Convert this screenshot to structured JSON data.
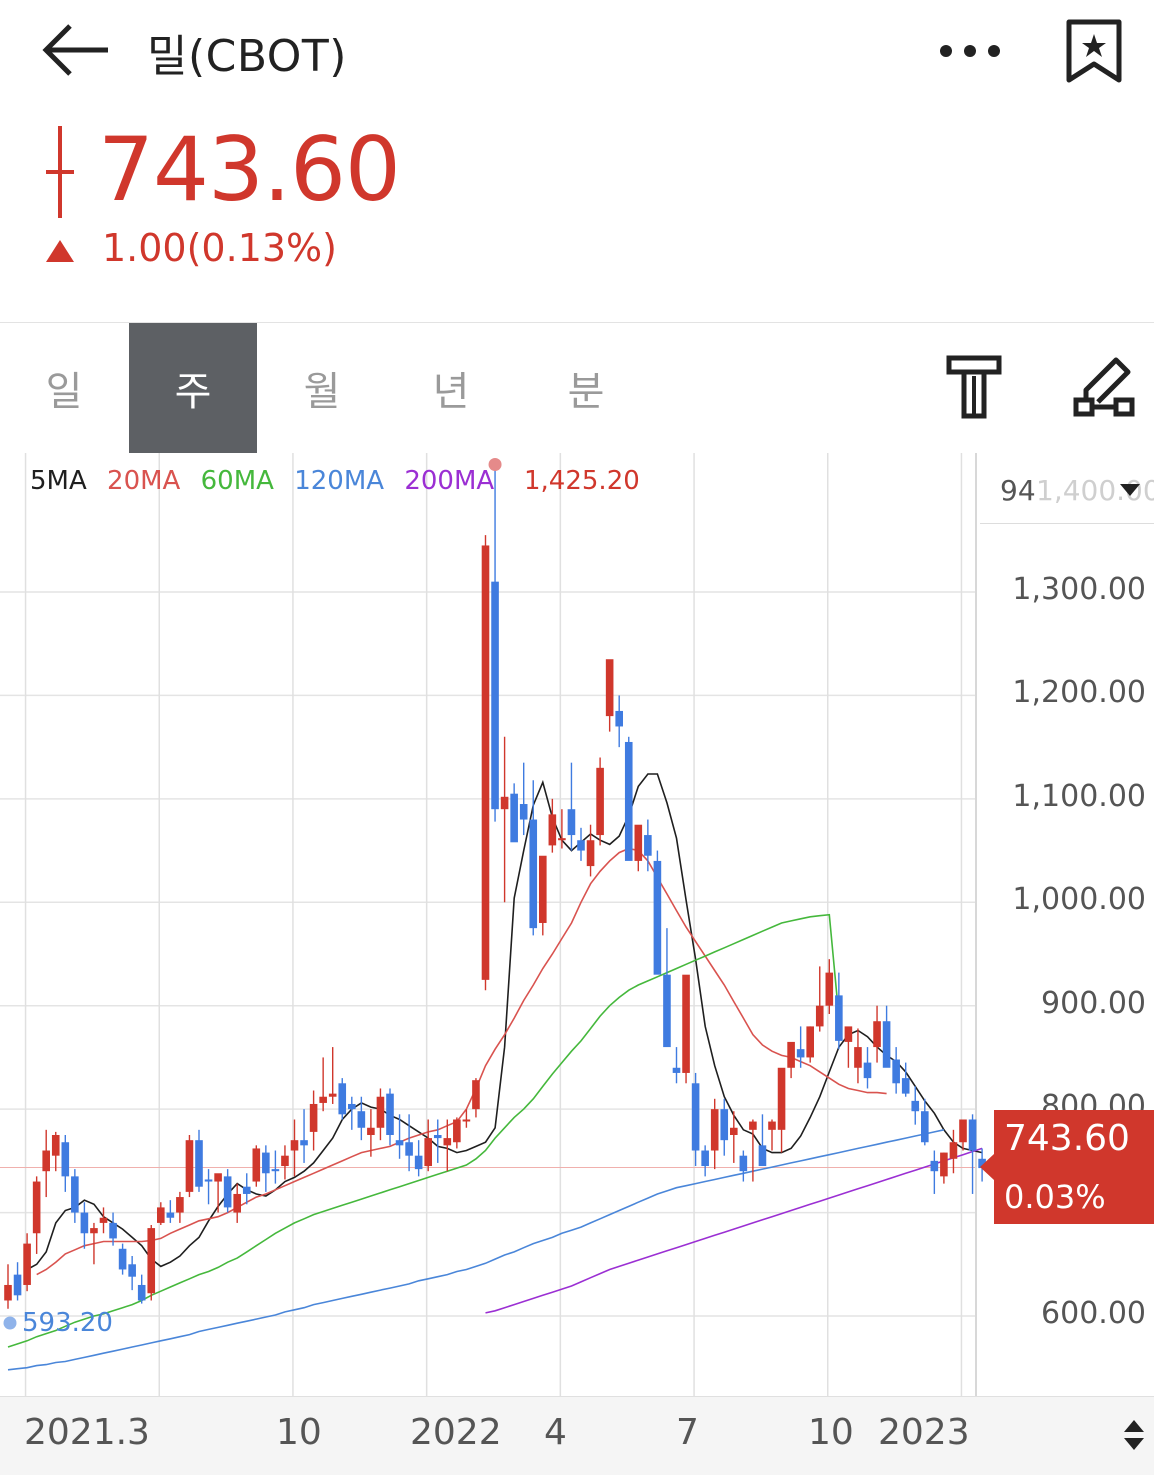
{
  "header": {
    "title": "밀(CBOT)",
    "icons": [
      "back-arrow-icon",
      "more-icon",
      "bookmark-star-icon"
    ]
  },
  "quote": {
    "price": "743.60",
    "change_text": "1.00(0.13%)",
    "direction": "up",
    "up_color": "#d0372c"
  },
  "tabs": [
    {
      "label": "일",
      "active": false
    },
    {
      "label": "주",
      "active": true
    },
    {
      "label": "월",
      "active": false
    },
    {
      "label": "년",
      "active": false
    },
    {
      "label": "분",
      "active": false
    }
  ],
  "toolbar": {
    "icons": [
      "indicator-settings-icon",
      "drawing-tool-icon"
    ]
  },
  "legend": {
    "ma5": "5MA",
    "ma20": "20MA",
    "ma60": "60MA",
    "ma120": "120MA",
    "ma200": "200MA"
  },
  "chart_labels": {
    "high": "1,425.20",
    "low": "593.20",
    "scale_value": "94",
    "scale_ghost": "1,400.00",
    "current_price": "743.60",
    "current_pct": "0.03%"
  },
  "chart_data": {
    "type": "candlestick",
    "interval": "weekly",
    "y_range": [
      530,
      1445
    ],
    "y_ticks": [
      {
        "value": 1300,
        "label": "1,300.00"
      },
      {
        "value": 1200,
        "label": "1,200.00"
      },
      {
        "value": 1100,
        "label": "1,100.00"
      },
      {
        "value": 1000,
        "label": "1,000.00"
      },
      {
        "value": 900,
        "label": "900.00"
      },
      {
        "value": 800,
        "label": "800.00"
      },
      {
        "value": 600,
        "label": "600.00"
      }
    ],
    "x_labels": [
      {
        "index": 9,
        "label": "2021.3"
      },
      {
        "index": 39,
        "label": "10"
      },
      {
        "index": 49,
        "label": "2022"
      },
      {
        "index": 63,
        "label": "4"
      },
      {
        "index": 76,
        "label": "7"
      },
      {
        "index": 90,
        "label": "10"
      },
      {
        "index": 100,
        "label": "2023"
      }
    ],
    "gridline_indices": [
      1,
      15,
      29,
      43,
      57,
      71,
      85,
      99
    ],
    "candles_ohlc": [
      [
        615,
        650,
        607,
        630
      ],
      [
        640,
        652,
        615,
        620
      ],
      [
        630,
        680,
        624,
        670
      ],
      [
        680,
        735,
        660,
        730
      ],
      [
        740,
        780,
        715,
        760
      ],
      [
        755,
        778,
        740,
        775
      ],
      [
        768,
        775,
        720,
        735
      ],
      [
        735,
        742,
        690,
        700
      ],
      [
        700,
        710,
        665,
        680
      ],
      [
        680,
        690,
        650,
        685
      ],
      [
        690,
        705,
        680,
        695
      ],
      [
        690,
        700,
        668,
        675
      ],
      [
        665,
        670,
        640,
        645
      ],
      [
        650,
        658,
        625,
        638
      ],
      [
        630,
        640,
        612,
        615
      ],
      [
        622,
        688,
        615,
        685
      ],
      [
        690,
        710,
        688,
        705
      ],
      [
        700,
        712,
        690,
        695
      ],
      [
        700,
        720,
        690,
        715
      ],
      [
        720,
        775,
        715,
        770
      ],
      [
        770,
        780,
        720,
        725
      ],
      [
        732,
        742,
        708,
        730
      ],
      [
        730,
        735,
        700,
        738
      ],
      [
        735,
        742,
        700,
        705
      ],
      [
        700,
        728,
        690,
        718
      ],
      [
        725,
        738,
        708,
        718
      ],
      [
        730,
        765,
        725,
        762
      ],
      [
        758,
        765,
        720,
        738
      ],
      [
        742,
        760,
        728,
        740
      ],
      [
        745,
        765,
        732,
        755
      ],
      [
        760,
        790,
        735,
        770
      ],
      [
        770,
        800,
        748,
        765
      ],
      [
        778,
        818,
        760,
        805
      ],
      [
        806,
        850,
        798,
        812
      ],
      [
        812,
        860,
        805,
        815
      ],
      [
        825,
        830,
        790,
        795
      ],
      [
        805,
        812,
        780,
        800
      ],
      [
        798,
        812,
        770,
        782
      ],
      [
        775,
        800,
        754,
        782
      ],
      [
        782,
        820,
        770,
        812
      ],
      [
        815,
        820,
        765,
        775
      ],
      [
        770,
        795,
        752,
        765
      ],
      [
        768,
        795,
        740,
        755
      ],
      [
        755,
        770,
        735,
        742
      ],
      [
        745,
        790,
        740,
        772
      ],
      [
        775,
        790,
        748,
        772
      ],
      [
        765,
        790,
        740,
        772
      ],
      [
        768,
        792,
        762,
        790
      ],
      [
        790,
        800,
        782,
        790
      ],
      [
        800,
        830,
        792,
        828
      ],
      [
        925,
        1355,
        915,
        1345
      ],
      [
        1310,
        1425,
        1078,
        1090
      ],
      [
        1090,
        1160,
        1000,
        1102
      ],
      [
        1105,
        1115,
        1060,
        1058
      ],
      [
        1095,
        1135,
        1065,
        1080
      ],
      [
        1080,
        1118,
        968,
        975
      ],
      [
        980,
        1030,
        968,
        1045
      ],
      [
        1055,
        1100,
        1048,
        1085
      ],
      [
        1060,
        1090,
        1052,
        1062
      ],
      [
        1090,
        1135,
        1050,
        1065
      ],
      [
        1060,
        1072,
        1040,
        1050
      ],
      [
        1035,
        1075,
        1025,
        1060
      ],
      [
        1065,
        1140,
        1055,
        1130
      ],
      [
        1180,
        1225,
        1165,
        1235
      ],
      [
        1185,
        1200,
        1150,
        1170
      ],
      [
        1155,
        1160,
        1090,
        1040
      ],
      [
        1040,
        1065,
        1030,
        1075
      ],
      [
        1065,
        1080,
        1030,
        1045
      ],
      [
        1040,
        1050,
        945,
        930
      ],
      [
        930,
        975,
        875,
        860
      ],
      [
        840,
        860,
        825,
        835
      ],
      [
        835,
        895,
        825,
        930
      ],
      [
        825,
        835,
        745,
        760
      ],
      [
        760,
        765,
        735,
        745
      ],
      [
        760,
        810,
        742,
        800
      ],
      [
        800,
        810,
        755,
        770
      ],
      [
        775,
        798,
        748,
        782
      ],
      [
        755,
        760,
        730,
        740
      ],
      [
        780,
        790,
        730,
        788
      ],
      [
        765,
        795,
        758,
        745
      ],
      [
        780,
        790,
        760,
        788
      ],
      [
        780,
        800,
        758,
        840
      ],
      [
        840,
        860,
        830,
        865
      ],
      [
        858,
        880,
        840,
        850
      ],
      [
        850,
        880,
        845,
        880
      ],
      [
        880,
        938,
        875,
        900
      ],
      [
        900,
        945,
        892,
        932
      ],
      [
        910,
        932,
        858,
        866
      ],
      [
        865,
        875,
        840,
        880
      ],
      [
        840,
        878,
        825,
        860
      ],
      [
        845,
        860,
        820,
        830
      ],
      [
        860,
        900,
        845,
        885
      ],
      [
        885,
        900,
        848,
        840
      ],
      [
        848,
        860,
        815,
        825
      ],
      [
        830,
        845,
        812,
        815
      ],
      [
        808,
        822,
        785,
        798
      ],
      [
        798,
        810,
        765,
        768
      ],
      [
        750,
        760,
        718,
        740
      ],
      [
        735,
        758,
        728,
        758
      ],
      [
        752,
        780,
        738,
        768
      ],
      [
        768,
        790,
        760,
        790
      ],
      [
        790,
        795,
        718,
        760
      ],
      [
        752,
        762,
        730,
        743
      ]
    ],
    "series": [
      {
        "name": "5MA",
        "color": "#1f1f1f",
        "start": 2,
        "values": [
          645,
          650,
          662,
          690,
          702,
          705,
          712,
          708,
          696,
          690,
          684,
          676,
          668,
          655,
          648,
          652,
          658,
          668,
          676,
          692,
          706,
          718,
          728,
          722,
          718,
          716,
          722,
          730,
          734,
          740,
          748,
          760,
          772,
          790,
          800,
          806,
          802,
          800,
          794,
          790,
          784,
          778,
          772,
          764,
          762,
          758,
          760,
          764,
          768,
          782,
          860,
          1004,
          1050,
          1094,
          1116,
          1082,
          1060,
          1050,
          1058,
          1066,
          1060,
          1056,
          1064,
          1084,
          1112,
          1124,
          1124,
          1096,
          1062,
          1002,
          945,
          880,
          842,
          812,
          794,
          780,
          776,
          762,
          758,
          758,
          762,
          774,
          792,
          812,
          836,
          860,
          872,
          876,
          870,
          860,
          852,
          846,
          836,
          822,
          808,
          796,
          780,
          768,
          762,
          760,
          758
        ]
      },
      {
        "name": "20MA",
        "color": "#d9534f",
        "start": 3,
        "values": [
          640,
          645,
          652,
          660,
          664,
          668,
          670,
          672,
          672,
          672,
          672,
          672,
          673,
          675,
          680,
          684,
          688,
          692,
          694,
          696,
          700,
          705,
          710,
          715,
          718,
          722,
          726,
          730,
          734,
          738,
          742,
          746,
          750,
          754,
          758,
          760,
          762,
          764,
          768,
          772,
          775,
          778,
          780,
          784,
          788,
          800,
          820,
          842,
          858,
          872,
          888,
          905,
          920,
          936,
          950,
          965,
          980,
          1000,
          1018,
          1030,
          1040,
          1048,
          1052,
          1050,
          1040,
          1024,
          1008,
          992,
          976,
          962,
          948,
          934,
          920,
          904,
          888,
          872,
          862,
          856,
          852,
          850,
          846,
          842,
          836,
          830,
          824,
          820,
          818,
          816,
          816,
          815
        ]
      },
      {
        "name": "60MA",
        "color": "#45b83c",
        "start": 0,
        "values": [
          570,
          573,
          576,
          580,
          583,
          586,
          590,
          594,
          597,
          600,
          602,
          605,
          608,
          611,
          615,
          620,
          624,
          628,
          632,
          636,
          640,
          643,
          647,
          652,
          656,
          662,
          668,
          674,
          680,
          685,
          690,
          694,
          698,
          701,
          704,
          707,
          710,
          713,
          716,
          719,
          722,
          725,
          728,
          731,
          734,
          737,
          740,
          743,
          746,
          752,
          760,
          772,
          782,
          792,
          800,
          810,
          822,
          834,
          845,
          856,
          866,
          878,
          890,
          900,
          908,
          915,
          920,
          924,
          928,
          932,
          936,
          940,
          944,
          948,
          952,
          956,
          960,
          964,
          968,
          972,
          976,
          980,
          982,
          984,
          986,
          987,
          988,
          889
        ]
      },
      {
        "name": "120MA",
        "color": "#4a86d9",
        "start": 0,
        "values": [
          548,
          549,
          550,
          552,
          553,
          555,
          556,
          558,
          560,
          562,
          564,
          566,
          568,
          570,
          572,
          574,
          576,
          578,
          580,
          582,
          585,
          587,
          589,
          591,
          593,
          595,
          597,
          599,
          601,
          604,
          606,
          608,
          611,
          613,
          615,
          617,
          619,
          621,
          623,
          625,
          627,
          629,
          631,
          634,
          636,
          638,
          640,
          643,
          645,
          648,
          651,
          655,
          659,
          662,
          666,
          670,
          673,
          676,
          680,
          683,
          686,
          690,
          694,
          698,
          702,
          706,
          710,
          714,
          718,
          721,
          724,
          726,
          728,
          730,
          732,
          734,
          736,
          738,
          740,
          742,
          744,
          746,
          748,
          750,
          752,
          754,
          756,
          758,
          760,
          762,
          764,
          766,
          768,
          770,
          772,
          774,
          776,
          778,
          780
        ]
      },
      {
        "name": "200MA",
        "color": "#9b2fd3",
        "start": 50,
        "values": [
          603,
          605,
          608,
          611,
          614,
          617,
          620,
          623,
          626,
          629,
          633,
          637,
          641,
          645,
          648,
          651,
          654,
          657,
          660,
          663,
          666,
          669,
          672,
          675,
          678,
          681,
          684,
          687,
          690,
          693,
          696,
          699,
          702,
          705,
          708,
          711,
          714,
          717,
          720,
          723,
          726,
          729,
          732,
          735,
          738,
          741,
          744,
          747,
          750,
          753,
          756,
          759,
          762
        ]
      }
    ]
  }
}
